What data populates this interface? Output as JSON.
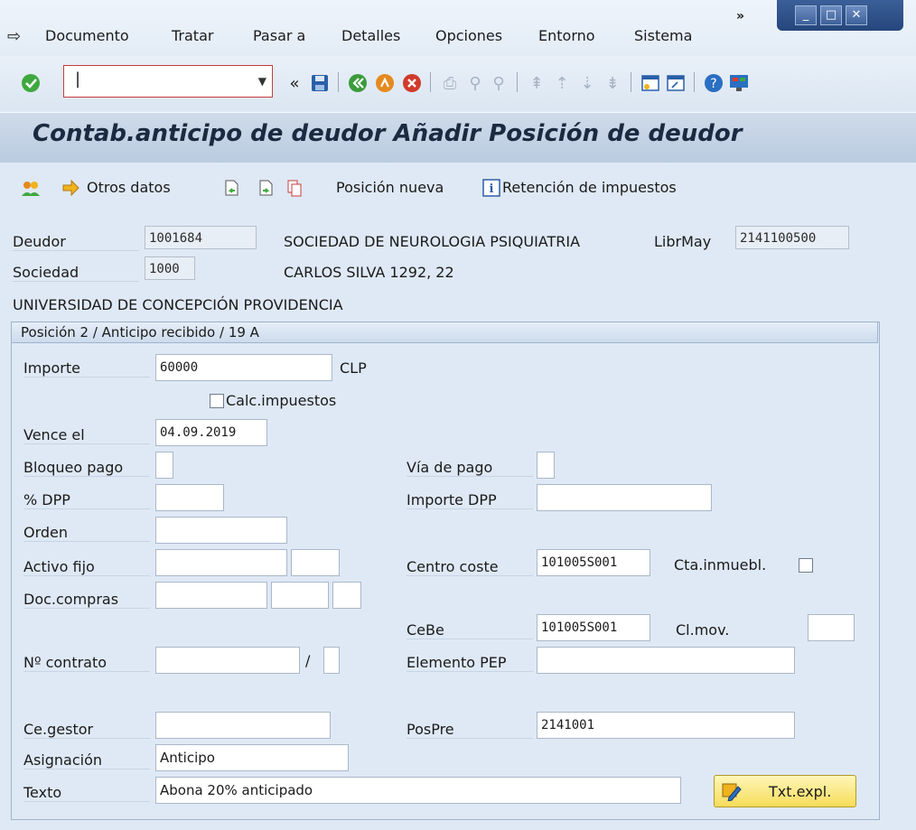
{
  "menu": {
    "items": [
      "Documento",
      "Tratar",
      "Pasar a",
      "Detalles",
      "Opciones",
      "Entorno",
      "Sistema"
    ],
    "overflow": "»"
  },
  "toolbar": {
    "command_value": "",
    "nav_back": "«"
  },
  "title": "Contab.anticipo de deudor Añadir Posición de deudor",
  "app_toolbar": {
    "otros_datos": "Otros datos",
    "posicion_nueva": "Posición nueva",
    "retencion": "Retención de impuestos"
  },
  "header": {
    "deudor_label": "Deudor",
    "deudor_value": "1001684",
    "deudor_name": "SOCIEDAD DE NEUROLOGIA PSIQUIATRIA",
    "librmay_label": "LibrMay",
    "librmay_value": "2141100500",
    "sociedad_label": "Sociedad",
    "sociedad_value": "1000",
    "address1": "CARLOS SILVA 1292, 22",
    "address2": "UNIVERSIDAD DE CONCEPCIÓN  PROVIDENCIA"
  },
  "group_title": "Posición 2 / Anticipo recibido / 19 A",
  "fields": {
    "importe_label": "Importe",
    "importe_value": "60000",
    "currency": "CLP",
    "calc_label": "Calc.impuestos",
    "vence_label": "Vence el",
    "vence_value": "04.09.2019",
    "bloqueo_label": "Bloqueo pago",
    "via_label": "Vía de pago",
    "dpp_pct_label": "% DPP",
    "importe_dpp_label": "Importe DPP",
    "orden_label": "Orden",
    "activo_label": "Activo fijo",
    "centro_label": "Centro coste",
    "centro_value": "101005S001",
    "cta_label": "Cta.inmuebl.",
    "doc_label": "Doc.compras",
    "cebe_label": "CeBe",
    "cebe_value": "101005S001",
    "clmov_label": "Cl.mov.",
    "contrato_label": "Nº contrato",
    "slash": "/",
    "pep_label": "Elemento PEP",
    "gestor_label": "Ce.gestor",
    "pospre_label": "PosPre",
    "pospre_value": "2141001",
    "asignacion_label": "Asignación",
    "asignacion_value": "Anticipo",
    "texto_label": "Texto",
    "texto_value": "Abona 20% anticipado",
    "txt_button": "Txt.expl."
  },
  "colors": {
    "background": "#dfe9f5",
    "accent": "#1f3f73",
    "button": "#f6dc5a"
  }
}
